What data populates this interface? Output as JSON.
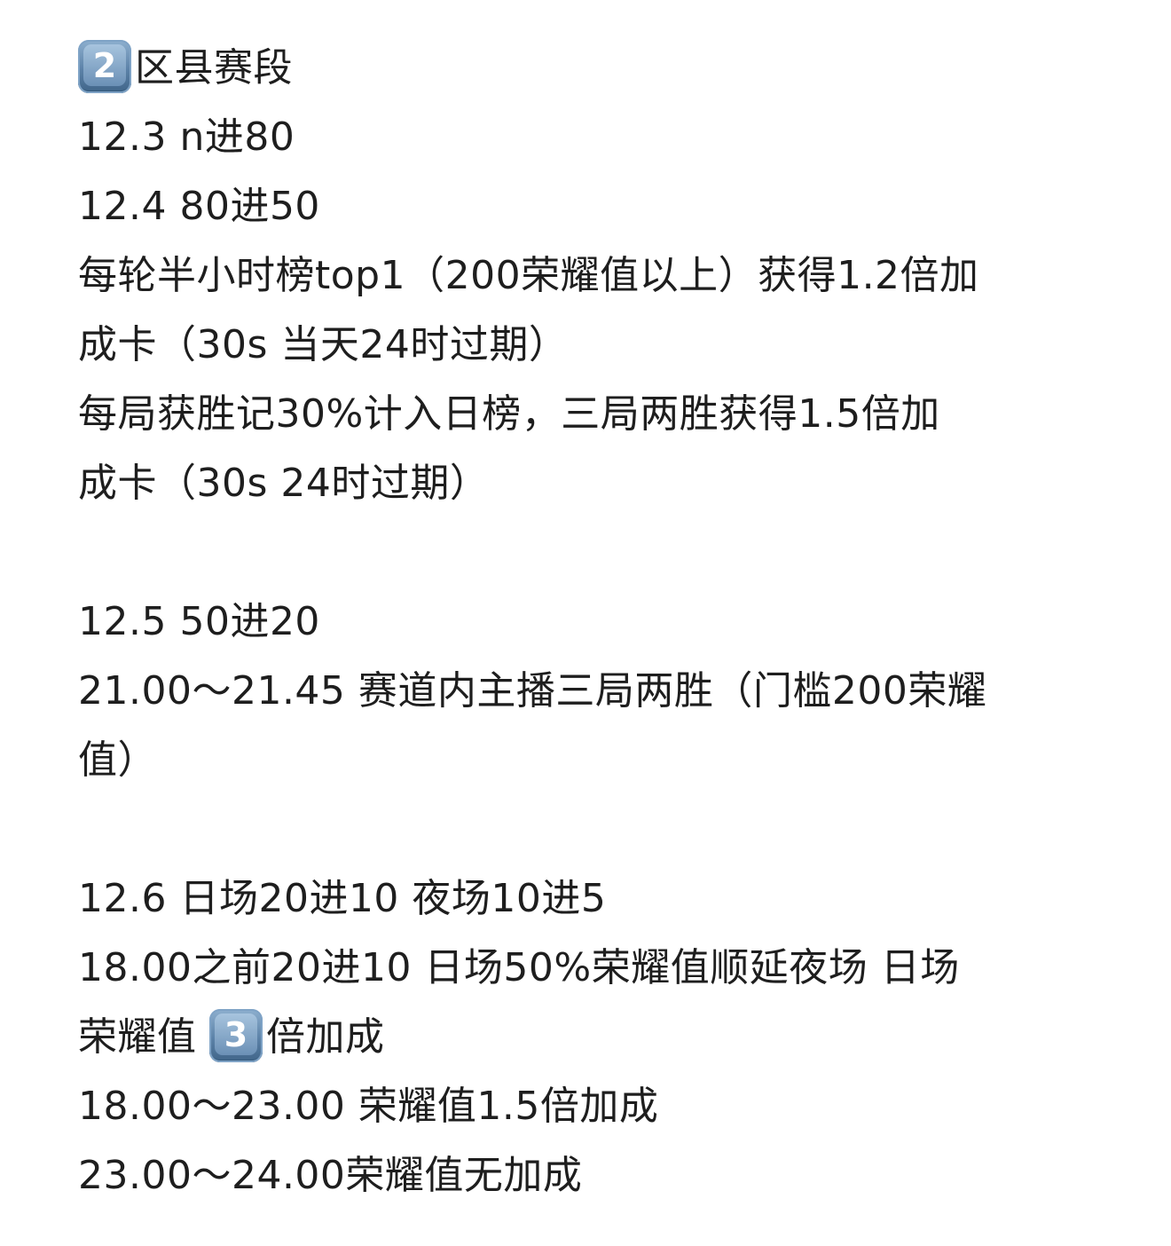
{
  "note": {
    "heading": {
      "keycap": "2",
      "text": "区县赛段"
    },
    "lines": {
      "l1": "12.3 n进80",
      "l2": "12.4 80进50",
      "l3": "每轮半小时榜top1（200荣耀值以上）获得1.2倍加",
      "l4": "成卡（30s 当天24时过期）",
      "l5": "每局获胜记30%计入日榜，三局两胜获得1.5倍加",
      "l6": "成卡（30s 24时过期）",
      "l7": "12.5 50进20",
      "l8": "21.00～21.45 赛道内主播三局两胜（门槛200荣耀",
      "l9": "值）",
      "l10": "12.6 日场20进10 夜场10进5",
      "l11": "18.00之前20进10 日场50%荣耀值顺延夜场 日场",
      "l12_before": "荣耀值",
      "l12_keycap": "3",
      "l12_after": "倍加成",
      "l13": "18.00～23.00 荣耀值1.5倍加成",
      "l14": "23.00～24.00荣耀值无加成"
    },
    "keycap_colors": {
      "top": "#8eb0cf",
      "bottom": "#3f6488"
    },
    "text_color": "#1e1e1e"
  }
}
